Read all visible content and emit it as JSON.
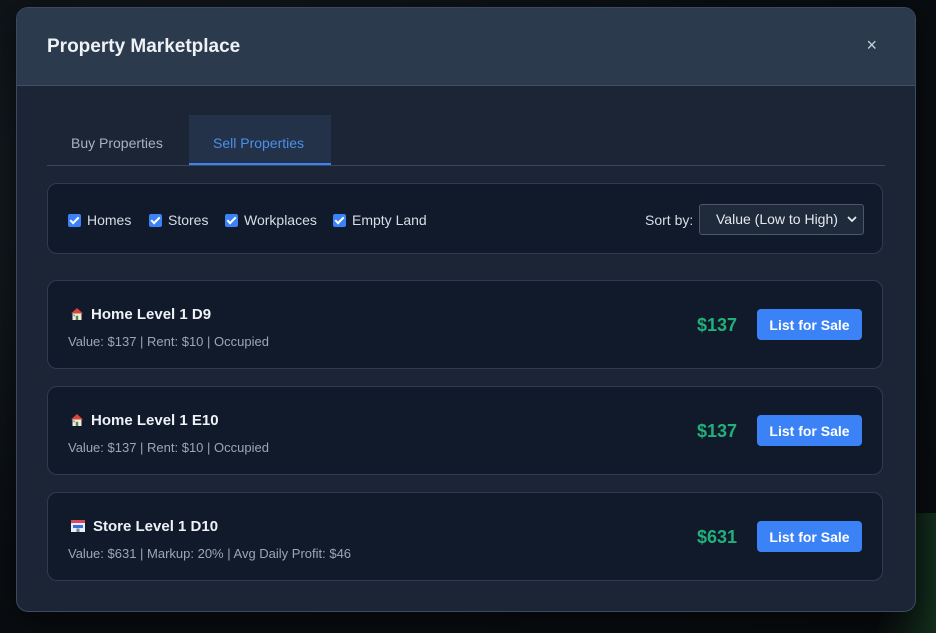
{
  "modal": {
    "title": "Property Marketplace",
    "close_label": "×"
  },
  "tabs": [
    {
      "label": "Buy Properties",
      "active": false
    },
    {
      "label": "Sell Properties",
      "active": true
    }
  ],
  "filters": {
    "items": [
      {
        "label": "Homes",
        "checked": true
      },
      {
        "label": "Stores",
        "checked": true
      },
      {
        "label": "Workplaces",
        "checked": true
      },
      {
        "label": "Empty Land",
        "checked": true
      }
    ],
    "sort_label": "Sort by:",
    "sort_value": "Value (Low to High)"
  },
  "properties": [
    {
      "icon": "house-icon",
      "name": "Home Level 1 D9",
      "details": "Value: $137 | Rent: $10 | Occupied",
      "price": "$137",
      "button_label": "List for Sale"
    },
    {
      "icon": "house-icon",
      "name": "Home Level 1 E10",
      "details": "Value: $137 | Rent: $10 | Occupied",
      "price": "$137",
      "button_label": "List for Sale"
    },
    {
      "icon": "store-icon",
      "name": "Store Level 1 D10",
      "details": "Value: $631 | Markup: 20% | Avg Daily Profit: $46",
      "price": "$631",
      "button_label": "List for Sale"
    }
  ],
  "colors": {
    "accent": "#3b82f6",
    "price": "#22b07a",
    "panel": "#1b2535",
    "card": "#111a2a"
  }
}
